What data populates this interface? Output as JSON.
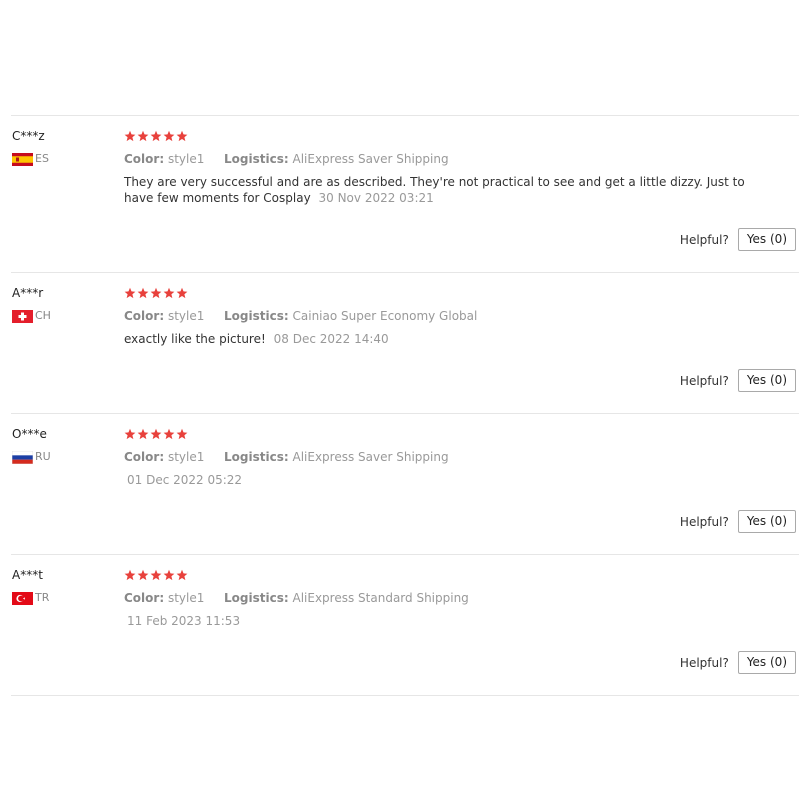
{
  "colors": {
    "star": "#e8413c",
    "divider": "#e6e6e6",
    "muted": "#999999"
  },
  "reviews": [
    {
      "user": "C***z",
      "country": "ES",
      "flag_icon": "spain-flag-icon",
      "rating": 5,
      "color_label": "Color:",
      "color_value": "style1",
      "logistics_label": "Logistics:",
      "logistics_value": "AliExpress Saver Shipping",
      "text": "They are very successful and are as described. They're not practical to see and get a little dizzy. Just to have few moments for Cosplay",
      "date": "30 Nov 2022 03:21",
      "helpful_label": "Helpful?",
      "yes_label": "Yes (0)"
    },
    {
      "user": "A***r",
      "country": "CH",
      "flag_icon": "switzerland-flag-icon",
      "rating": 5,
      "color_label": "Color:",
      "color_value": "style1",
      "logistics_label": "Logistics:",
      "logistics_value": "Cainiao Super Economy Global",
      "text": "exactly like the picture!",
      "date": "08 Dec 2022 14:40",
      "helpful_label": "Helpful?",
      "yes_label": "Yes (0)"
    },
    {
      "user": "O***e",
      "country": "RU",
      "flag_icon": "russia-flag-icon",
      "rating": 5,
      "color_label": "Color:",
      "color_value": "style1",
      "logistics_label": "Logistics:",
      "logistics_value": "AliExpress Saver Shipping",
      "text": "",
      "date": "01 Dec 2022 05:22",
      "helpful_label": "Helpful?",
      "yes_label": "Yes (0)"
    },
    {
      "user": "A***t",
      "country": "TR",
      "flag_icon": "turkey-flag-icon",
      "rating": 5,
      "color_label": "Color:",
      "color_value": "style1",
      "logistics_label": "Logistics:",
      "logistics_value": "AliExpress Standard Shipping",
      "text": "",
      "date": "11 Feb 2023 11:53",
      "helpful_label": "Helpful?",
      "yes_label": "Yes (0)"
    }
  ]
}
